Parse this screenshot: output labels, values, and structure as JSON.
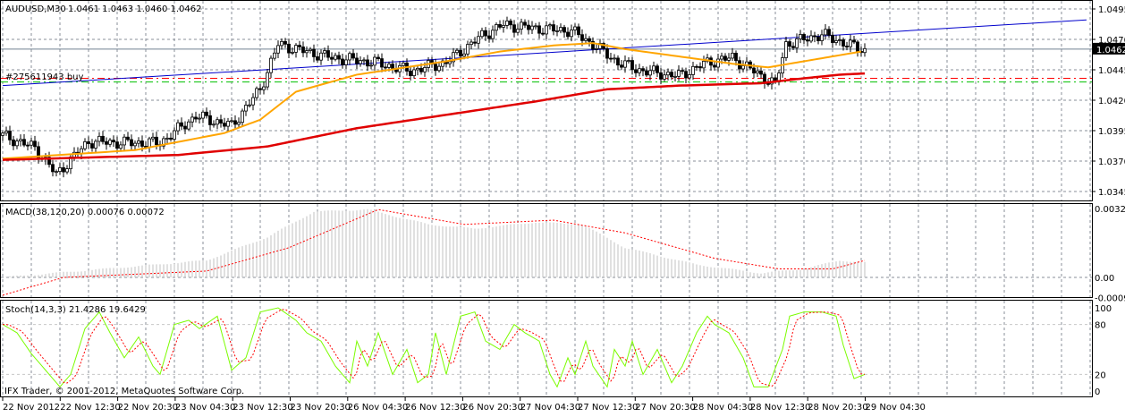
{
  "colors": {
    "bull_body": "#ffffff",
    "bear_body": "#000000",
    "wick": "#000000",
    "ma_fast": "#ffa500",
    "ma_slow": "#e00000",
    "trendline": "#0000cc",
    "order_line": "#ff0000",
    "sl_line": "#00c000",
    "macd_hist": "#c0c0c0",
    "macd_signal": "#ff0000",
    "stoch_main": "#7cfc00",
    "stoch_signal": "#ff0000",
    "bid_line": "#708090",
    "bid_label_bg": "#000000"
  },
  "header": {
    "symbol_tf": "AUDUSD,M30",
    "ohlc": "1.0461 1.0463 1.0460 1.0462"
  },
  "order_label": "#275611943 buy",
  "macd_label": "MACD(38,120,20) 0.00076 0.00072",
  "stoch_label": "Stoch(14,3,3) 21.4286 19.6429",
  "copyright": "IFX Trader, © 2001-2012, MetaQuotes Software Corp.",
  "chart_data": [
    {
      "type": "candlestick",
      "title": "AUDUSD,M30",
      "bars": 242,
      "ylim": [
        1.0335,
        1.0502
      ],
      "price_ticks": [
        "1.0495",
        "1.0470",
        "1.0445",
        "1.0420",
        "1.0395",
        "1.0370",
        "1.0345"
      ],
      "current_price": "1.0462",
      "close_path": [
        [
          0,
          1.0391
        ],
        [
          9,
          1.0381
        ],
        [
          15,
          1.0359
        ],
        [
          24,
          1.0386
        ],
        [
          34,
          1.0385
        ],
        [
          44,
          1.0385
        ],
        [
          54,
          1.0407
        ],
        [
          64,
          1.0399
        ],
        [
          72,
          1.0429
        ],
        [
          77,
          1.0466
        ],
        [
          82,
          1.0462
        ],
        [
          92,
          1.0455
        ],
        [
          104,
          1.0451
        ],
        [
          114,
          1.0444
        ],
        [
          124,
          1.0451
        ],
        [
          134,
          1.0473
        ],
        [
          140,
          1.0482
        ],
        [
          149,
          1.0479
        ],
        [
          159,
          1.0477
        ],
        [
          165,
          1.0466
        ],
        [
          172,
          1.0451
        ],
        [
          179,
          1.0444
        ],
        [
          189,
          1.044
        ],
        [
          197,
          1.0451
        ],
        [
          204,
          1.0455
        ],
        [
          212,
          1.044
        ],
        [
          216,
          1.0433
        ],
        [
          219,
          1.0466
        ],
        [
          229,
          1.0474
        ],
        [
          237,
          1.0465
        ],
        [
          241,
          1.0461
        ]
      ],
      "ma_fast": [
        [
          0,
          1.0372
        ],
        [
          37,
          1.0379
        ],
        [
          62,
          1.0393
        ],
        [
          72,
          1.0404
        ],
        [
          82,
          1.0427
        ],
        [
          99,
          1.0441
        ],
        [
          124,
          1.0452
        ],
        [
          139,
          1.046
        ],
        [
          154,
          1.0465
        ],
        [
          165,
          1.0467
        ],
        [
          174,
          1.0462
        ],
        [
          189,
          1.0456
        ],
        [
          204,
          1.045
        ],
        [
          214,
          1.0447
        ],
        [
          224,
          1.0452
        ],
        [
          240,
          1.046
        ]
      ],
      "ma_slow": [
        [
          0,
          1.0371
        ],
        [
          49,
          1.0375
        ],
        [
          74,
          1.0382
        ],
        [
          99,
          1.0397
        ],
        [
          124,
          1.0408
        ],
        [
          149,
          1.0419
        ],
        [
          169,
          1.0429
        ],
        [
          189,
          1.0432
        ],
        [
          212,
          1.0434
        ],
        [
          224,
          1.0438
        ],
        [
          234,
          1.0441
        ],
        [
          241,
          1.0442
        ]
      ],
      "trendline": [
        [
          0,
          1.0432
        ],
        [
          303,
          1.0486
        ]
      ],
      "order_price": 1.0438,
      "sl_price": 1.0435,
      "x_labels": [
        "22 Nov 2012",
        "22 Nov 12:30",
        "22 Nov 20:30",
        "23 Nov 04:30",
        "23 Nov 12:30",
        "23 Nov 20:30",
        "26 Nov 04:30",
        "26 Nov 12:30",
        "26 Nov 20:30",
        "27 Nov 04:30",
        "27 Nov 12:30",
        "27 Nov 20:30",
        "28 Nov 04:30",
        "28 Nov 12:30",
        "28 Nov 20:30",
        "29 Nov 04:30"
      ]
    },
    {
      "type": "macd",
      "ylim": [
        -0.00095,
        0.00325
      ],
      "y_ticks": [
        "0.00325",
        "0.00",
        "-0.00095"
      ],
      "histogram": [
        [
          0,
          0.0
        ],
        [
          57,
          0.0008
        ],
        [
          74,
          0.0019
        ],
        [
          87,
          0.0031
        ],
        [
          102,
          0.0032
        ],
        [
          119,
          0.0025
        ],
        [
          132,
          0.0023
        ],
        [
          149,
          0.0026
        ],
        [
          162,
          0.0025
        ],
        [
          174,
          0.0014
        ],
        [
          194,
          0.0006
        ],
        [
          212,
          0.0002
        ],
        [
          224,
          0.0004
        ],
        [
          234,
          0.0008
        ],
        [
          241,
          0.0007
        ]
      ],
      "signal": [
        [
          0,
          -0.00084
        ],
        [
          17,
          0.0
        ],
        [
          57,
          0.0003
        ],
        [
          80,
          0.0014
        ],
        [
          105,
          0.0032
        ],
        [
          129,
          0.0025
        ],
        [
          154,
          0.0027
        ],
        [
          174,
          0.0021
        ],
        [
          199,
          0.0009
        ],
        [
          217,
          0.0004
        ],
        [
          232,
          0.0004
        ],
        [
          241,
          0.0008
        ]
      ]
    },
    {
      "type": "stochastic",
      "ylim": [
        0,
        100
      ],
      "y_ticks": [
        "100",
        "80",
        "20",
        "0"
      ],
      "main": [
        [
          0,
          80
        ],
        [
          4,
          70
        ],
        [
          8,
          45
        ],
        [
          12,
          25
        ],
        [
          16,
          5
        ],
        [
          19,
          20
        ],
        [
          23,
          75
        ],
        [
          27,
          95
        ],
        [
          30,
          70
        ],
        [
          34,
          40
        ],
        [
          38,
          65
        ],
        [
          42,
          30
        ],
        [
          44,
          20
        ],
        [
          48,
          80
        ],
        [
          52,
          85
        ],
        [
          55,
          75
        ],
        [
          60,
          90
        ],
        [
          64,
          25
        ],
        [
          68,
          40
        ],
        [
          72,
          95
        ],
        [
          77,
          100
        ],
        [
          82,
          85
        ],
        [
          85,
          70
        ],
        [
          89,
          60
        ],
        [
          93,
          30
        ],
        [
          97,
          10
        ],
        [
          99,
          60
        ],
        [
          102,
          30
        ],
        [
          105,
          70
        ],
        [
          109,
          20
        ],
        [
          113,
          50
        ],
        [
          116,
          10
        ],
        [
          119,
          20
        ],
        [
          121,
          70
        ],
        [
          124,
          20
        ],
        [
          128,
          90
        ],
        [
          132,
          95
        ],
        [
          135,
          60
        ],
        [
          139,
          50
        ],
        [
          143,
          80
        ],
        [
          146,
          70
        ],
        [
          150,
          60
        ],
        [
          153,
          20
        ],
        [
          155,
          5
        ],
        [
          158,
          40
        ],
        [
          160,
          20
        ],
        [
          163,
          60
        ],
        [
          165,
          30
        ],
        [
          169,
          5
        ],
        [
          171,
          50
        ],
        [
          174,
          30
        ],
        [
          176,
          60
        ],
        [
          179,
          20
        ],
        [
          183,
          50
        ],
        [
          187,
          10
        ],
        [
          190,
          30
        ],
        [
          194,
          70
        ],
        [
          197,
          90
        ],
        [
          199,
          80
        ],
        [
          203,
          70
        ],
        [
          207,
          40
        ],
        [
          210,
          5
        ],
        [
          214,
          5
        ],
        [
          218,
          50
        ],
        [
          220,
          90
        ],
        [
          224,
          95
        ],
        [
          229,
          95
        ],
        [
          233,
          90
        ],
        [
          235,
          55
        ],
        [
          238,
          15
        ],
        [
          241,
          20
        ]
      ]
    }
  ]
}
